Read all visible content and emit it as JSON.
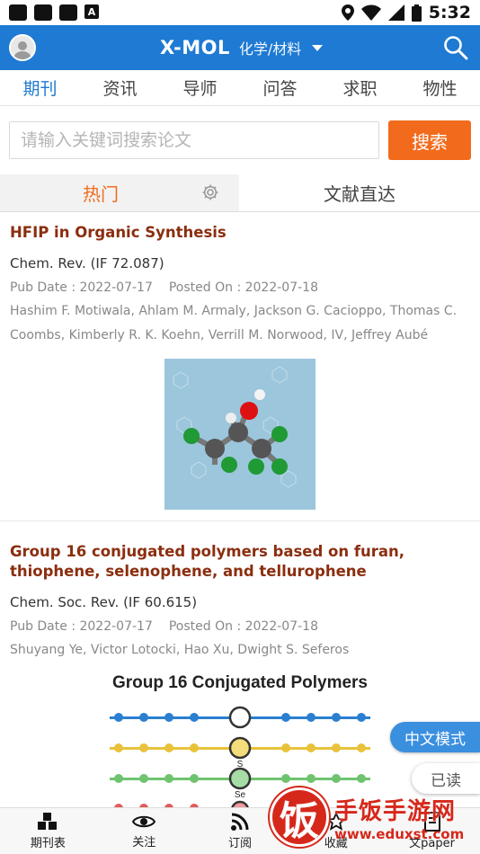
{
  "status_bar": {
    "time": "5:32"
  },
  "header": {
    "title": "X-MOL",
    "category": "化学/材料"
  },
  "main_tabs": [
    "期刊",
    "资讯",
    "导师",
    "问答",
    "求职",
    "物性"
  ],
  "search": {
    "placeholder": "请输入关键词搜索论文",
    "button": "搜索"
  },
  "sub_tabs": {
    "hot": "热门",
    "direct": "文献直达"
  },
  "articles": [
    {
      "title": "HFIP in Organic Synthesis",
      "journal": "Chem. Rev. (IF 72.087)",
      "pub_date": "Pub Date : 2022-07-17",
      "posted_on": "Posted On : 2022-07-18",
      "authors": "Hashim F. Motiwala, Ahlam M. Armaly, Jackson G. Cacioppo, Thomas C. Coombs, Kimberly R. K. Koehn, Verrill M. Norwood, IV, Jeffrey Aubé"
    },
    {
      "title": "Group 16 conjugated polymers based on furan, thiophene, selenophene, and tellurophene",
      "journal": "Chem. Soc. Rev. (IF 60.615)",
      "pub_date": "Pub Date : 2022-07-17",
      "posted_on": "Posted On : 2022-07-18",
      "authors": "Shuyang Ye, Victor Lotocki, Hao Xu, Dwight S. Seferos",
      "image_title": "Group 16 Conjugated Polymers",
      "ring_labels": [
        "S",
        "Se"
      ]
    }
  ],
  "floating": {
    "chinese_mode": "中文模式",
    "read": "已读"
  },
  "bottom_nav": [
    "期刊表",
    "关注",
    "订阅",
    "收藏",
    "文paper"
  ],
  "watermark": {
    "logo": "饭",
    "name": "手饭手游网",
    "url": "www.eduxst.com"
  },
  "colors": {
    "brand_blue": "#1e7ad3",
    "accent_orange": "#f26b1d",
    "title_brown": "#8b2e0f"
  }
}
